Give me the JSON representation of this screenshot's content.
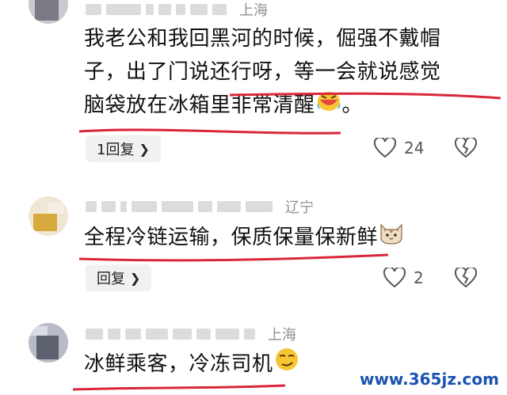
{
  "comments": [
    {
      "location": "上海",
      "lines": [
        "我老公和我回黑河的时候，倔强不戴帽",
        "子，出了门说还行呀，等一会就说感觉",
        "脑袋放在冰箱里非常清醒"
      ],
      "tail": "。",
      "reply_label": "1回复",
      "like_count": "24"
    },
    {
      "location": "辽宁",
      "lines": [
        "全程冷链运输，保质保量保新鲜"
      ],
      "reply_label": "回复",
      "like_count": "2"
    },
    {
      "location": "上海",
      "lines": [
        "冰鲜乘客，冷冻司机"
      ]
    }
  ],
  "watermark": "www.365jz.com",
  "colors": {
    "underline": "#d9263a",
    "watermark": "#1b53b0",
    "location": "#8f8f8f"
  },
  "icons": [
    "heart-outline-icon",
    "broken-heart-icon",
    "chevron-right-icon"
  ]
}
